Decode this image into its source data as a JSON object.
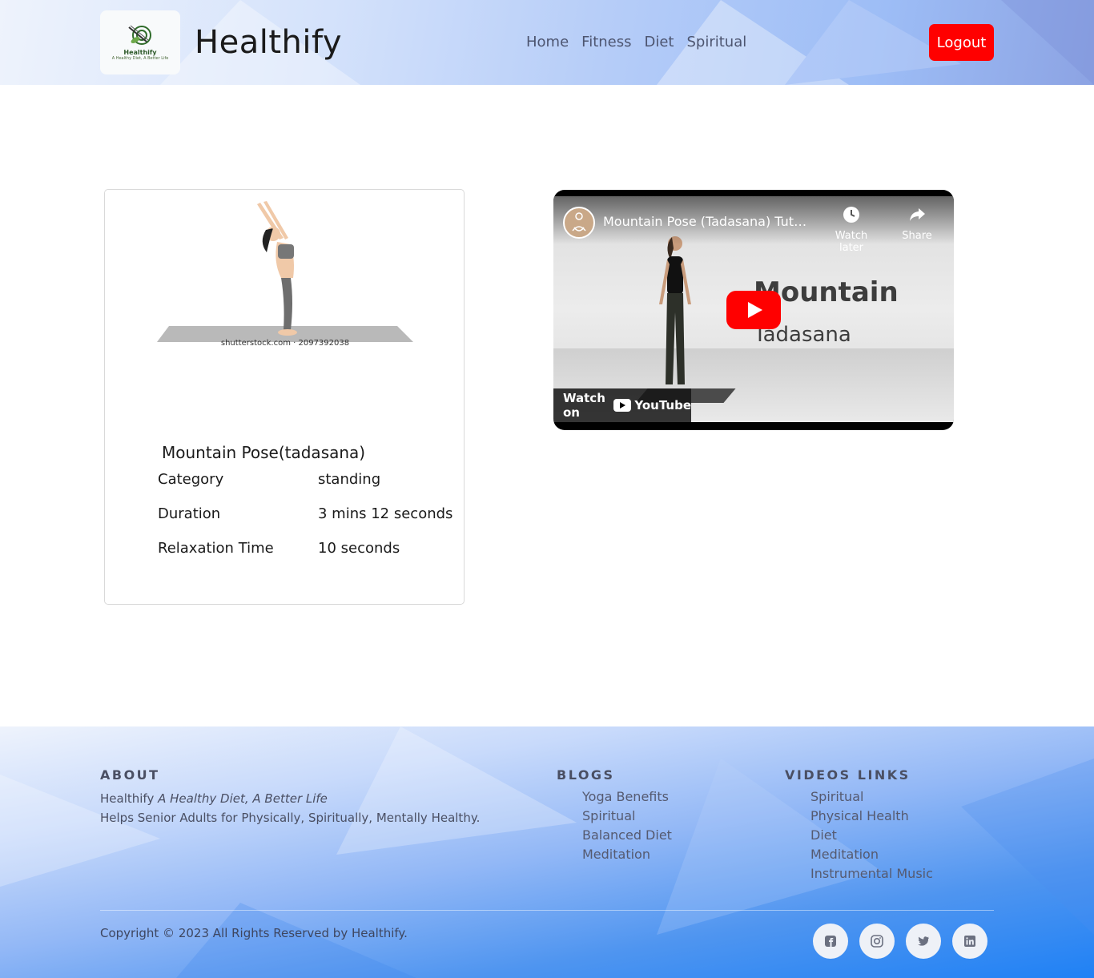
{
  "header": {
    "logo_name": "Healthify",
    "logo_tagline": "A Healthy Diet, A Better Life",
    "brand": "Healthify",
    "nav": [
      "Home",
      "Fitness",
      "Diet",
      "Spiritual"
    ],
    "logout_label": "Logout"
  },
  "pose": {
    "image_watermark": "shutterstock.com · 2097392038",
    "title": "Mountain Pose(tadasana)",
    "details": [
      {
        "label": "Category",
        "value": "standing"
      },
      {
        "label": "Duration",
        "value": "3 mins 12 seconds"
      },
      {
        "label": "Relaxation Time",
        "value": "10 seconds"
      }
    ]
  },
  "video": {
    "title": "Mountain Pose (Tadasana) Tut…",
    "watch_later": "Watch later",
    "share": "Share",
    "overlay_text_1": "Mountain",
    "overlay_text_2": "Tadasana",
    "watch_on": "Watch on",
    "youtube": "YouTube"
  },
  "footer": {
    "about_heading": "ABOUT",
    "about_brand": "Healthify",
    "about_tagline": "A Healthy Diet, A Better Life",
    "about_text": "Helps Senior Adults for Physically, Spiritually, Mentally Healthy.",
    "blogs_heading": "BLOGS",
    "blogs": [
      "Yoga Benefits",
      "Spiritual",
      "Balanced Diet",
      "Meditation"
    ],
    "videos_heading": "VIDEOS LINKS",
    "videos": [
      "Spiritual",
      "Physical Health",
      "Diet",
      "Meditation",
      "Instrumental Music"
    ],
    "copyright_prefix": "Copyright © 2023 All Rights Reserved by",
    "copyright_brand": "Healthify.",
    "social_icons": [
      "facebook-icon",
      "instagram-icon",
      "twitter-icon",
      "linkedin-icon"
    ]
  },
  "colors": {
    "logout_bg": "#ff0000",
    "play_button": "#ff0000",
    "footer_gradient_end": "#1f81f5"
  }
}
